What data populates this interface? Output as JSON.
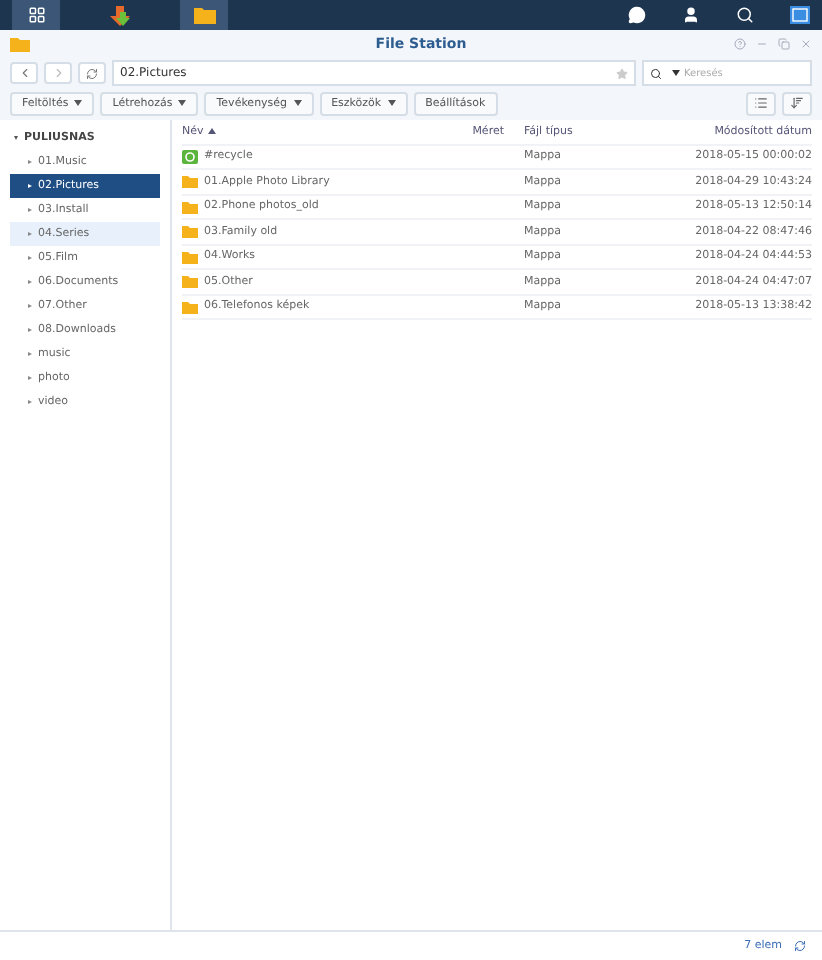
{
  "window": {
    "title": "File Station"
  },
  "nav": {
    "path": "02.Pictures",
    "search_placeholder": "Keresés"
  },
  "toolbar": [
    {
      "label": "Feltöltés",
      "dropdown": true
    },
    {
      "label": "Létrehozás",
      "dropdown": true
    },
    {
      "label": "Tevékenység",
      "dropdown": true
    },
    {
      "label": "Eszközök",
      "dropdown": true
    },
    {
      "label": "Beállítások",
      "dropdown": false
    }
  ],
  "sidebar": {
    "root": "PULIUSNAS",
    "items": [
      {
        "label": "01.Music",
        "selected": false,
        "hovered": false
      },
      {
        "label": "02.Pictures",
        "selected": true,
        "hovered": false
      },
      {
        "label": "03.Install",
        "selected": false,
        "hovered": false
      },
      {
        "label": "04.Series",
        "selected": false,
        "hovered": true
      },
      {
        "label": "05.Film",
        "selected": false,
        "hovered": false
      },
      {
        "label": "06.Documents",
        "selected": false,
        "hovered": false
      },
      {
        "label": "07.Other",
        "selected": false,
        "hovered": false
      },
      {
        "label": "08.Downloads",
        "selected": false,
        "hovered": false
      },
      {
        "label": "music",
        "selected": false,
        "hovered": false
      },
      {
        "label": "photo",
        "selected": false,
        "hovered": false
      },
      {
        "label": "video",
        "selected": false,
        "hovered": false
      }
    ]
  },
  "table": {
    "columns": [
      "Név",
      "Méret",
      "Fájl típus",
      "Módosított dátum"
    ],
    "rows": [
      {
        "kind": "recycle",
        "name": "#recycle",
        "type": "Mappa",
        "modified": "2018-05-15 00:00:02"
      },
      {
        "kind": "folder",
        "name": "01.Apple Photo Library",
        "type": "Mappa",
        "modified": "2018-04-29 10:43:24"
      },
      {
        "kind": "folder",
        "name": "02.Phone photos_old",
        "type": "Mappa",
        "modified": "2018-05-13 12:50:14"
      },
      {
        "kind": "folder",
        "name": "03.Family old",
        "type": "Mappa",
        "modified": "2018-04-22 08:47:46"
      },
      {
        "kind": "folder",
        "name": "04.Works",
        "type": "Mappa",
        "modified": "2018-04-24 04:44:53"
      },
      {
        "kind": "folder",
        "name": "05.Other",
        "type": "Mappa",
        "modified": "2018-04-24 04:47:07"
      },
      {
        "kind": "folder",
        "name": "06.Telefonos képek",
        "type": "Mappa",
        "modified": "2018-05-13 13:38:42"
      }
    ]
  },
  "status_bar": {
    "count": "7 elem"
  }
}
